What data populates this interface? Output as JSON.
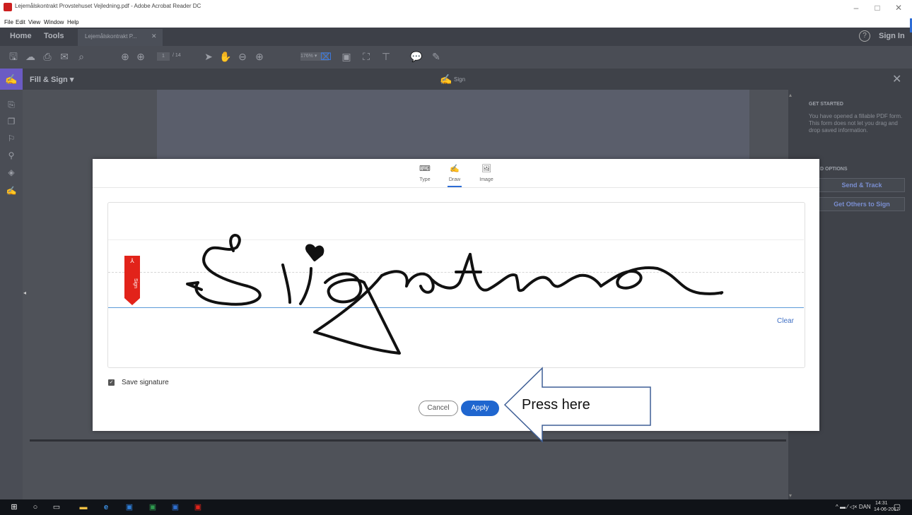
{
  "window": {
    "title": "Lejemålskontrakt Provstehuset Vejledning.pdf - Adobe Acrobat Reader DC",
    "minimize_icon": "minimize-icon",
    "maximize_icon": "maximize-icon",
    "close_icon": "close-icon"
  },
  "menu": [
    "File",
    "Edit",
    "View",
    "Window",
    "Help"
  ],
  "tabs": {
    "home": "Home",
    "tools": "Tools",
    "document": "Lejemålskontrakt P...",
    "sign_in": "Sign In"
  },
  "toolbar": {
    "page_current": "1",
    "page_total": "/ 14",
    "zoom": "176%"
  },
  "fill_sign": {
    "label": "Fill & Sign",
    "center_label": "Sign"
  },
  "right_panel": {
    "get_started_title": "GET STARTED",
    "get_started_text": "You have opened a fillable PDF form. This form does not let you drag and drop saved information.",
    "options_title": "D OPTIONS",
    "send_track": "Send & Track",
    "get_others": "Get Others to Sign"
  },
  "dialog": {
    "tabs": [
      {
        "label": "Type",
        "icon": "keyboard-icon"
      },
      {
        "label": "Draw",
        "icon": "pen-icon"
      },
      {
        "label": "Image",
        "icon": "image-icon"
      }
    ],
    "active_tab": "Draw",
    "sign_flag": "Sign",
    "clear": "Clear",
    "save_signature": "Save signature",
    "save_signature_checked": true,
    "cancel": "Cancel",
    "apply": "Apply"
  },
  "callout": {
    "text": "Press here"
  },
  "taskbar": {
    "language": "DAN",
    "time": "14:31",
    "date": "14-06-2017"
  },
  "colors": {
    "accent": "#1f66cf",
    "acrobat_red": "#e2231a",
    "fill_sign_badge": "#6b5bc4"
  }
}
